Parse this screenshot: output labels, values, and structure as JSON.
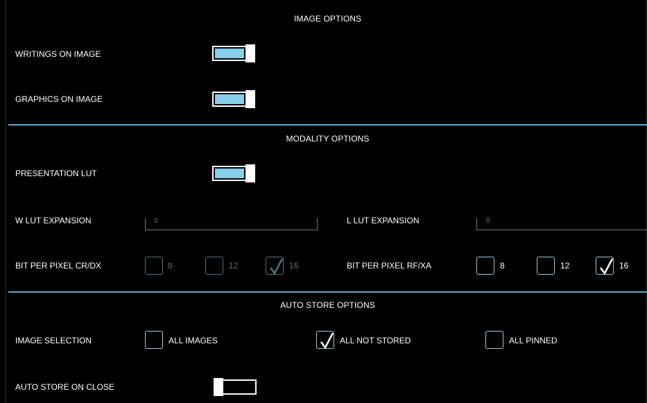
{
  "image_options": {
    "title": "IMAGE OPTIONS",
    "writings_label": "WRITINGS ON IMAGE",
    "writings_state": "on",
    "graphics_label": "GRAPHICS ON IMAGE",
    "graphics_state": "on"
  },
  "modality_options": {
    "title": "MODALITY OPTIONS",
    "presentation_lut_label": "PRESENTATION LUT",
    "presentation_lut_state": "on",
    "w_lut_label": "W LUT EXPANSION",
    "w_lut_value": "0",
    "l_lut_label": "L LUT EXPANSION",
    "l_lut_value": "0",
    "bpp_crdx_label": "BIT PER PIXEL CR/DX",
    "bpp_crdx_options": [
      {
        "label": "8",
        "checked": false
      },
      {
        "label": "12",
        "checked": false
      },
      {
        "label": "16",
        "checked": true
      }
    ],
    "bpp_rfxa_label": "BIT PER PIXEL RF/XA",
    "bpp_rfxa_options": [
      {
        "label": "8",
        "checked": false
      },
      {
        "label": "12",
        "checked": false
      },
      {
        "label": "16",
        "checked": true
      }
    ]
  },
  "auto_store_options": {
    "title": "AUTO STORE OPTIONS",
    "image_selection_label": "IMAGE SELECTION",
    "selection_options": [
      {
        "label": "ALL IMAGES",
        "checked": false
      },
      {
        "label": "ALL NOT STORED",
        "checked": true
      },
      {
        "label": "ALL PINNED",
        "checked": false
      }
    ],
    "auto_store_close_label": "AUTO STORE ON CLOSE",
    "auto_store_close_state": "off"
  },
  "colors": {
    "accent": "#87ceeb",
    "divider": "#5fa8c8",
    "background": "#000000"
  }
}
